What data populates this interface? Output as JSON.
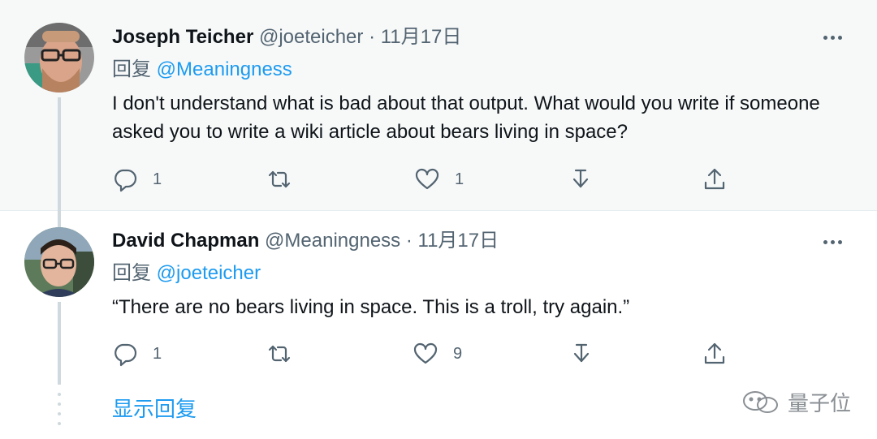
{
  "tweets": [
    {
      "name": "Joseph Teicher",
      "handle": "@joeteicher",
      "separator": "·",
      "date": "11月17日",
      "reply_prefix": "回复",
      "reply_mention": "@Meaningness",
      "text": "I don't understand what is bad about that output. What would you write if someone asked you to write a wiki article about bears living in space?",
      "reply_count": "1",
      "retweet_count": "",
      "like_count": "1"
    },
    {
      "name": "David Chapman",
      "handle": "@Meaningness",
      "separator": "·",
      "date": "11月17日",
      "reply_prefix": "回复",
      "reply_mention": "@joeteicher",
      "text": "“There are no bears living in space. This is a troll, try again.”",
      "reply_count": "1",
      "retweet_count": "",
      "like_count": "9"
    }
  ],
  "show_replies_label": "显示回复",
  "watermark_text": "量子位",
  "icons": [
    "reply-icon",
    "retweet-icon",
    "like-icon",
    "downvote-icon",
    "share-icon",
    "more-icon",
    "wechat-icon"
  ],
  "colors": {
    "accent": "#1d9bf0",
    "muted": "#536471",
    "first_bg": "#f7f9f9"
  }
}
